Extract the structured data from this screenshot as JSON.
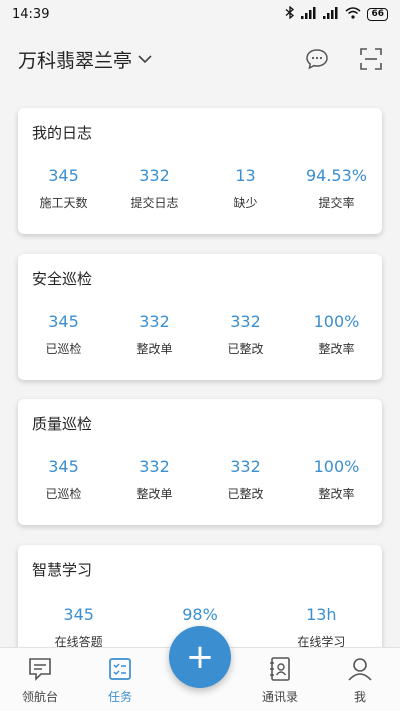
{
  "status_bar": {
    "time": "14:39",
    "battery": "66"
  },
  "header": {
    "project": "万科翡翠兰亭"
  },
  "cards": {
    "log": {
      "title": "我的日志",
      "stats": [
        {
          "value": "345",
          "label": "施工天数"
        },
        {
          "value": "332",
          "label": "提交日志"
        },
        {
          "value": "13",
          "label": "缺少"
        },
        {
          "value": "94.53%",
          "label": "提交率"
        }
      ]
    },
    "safety": {
      "title": "安全巡检",
      "stats": [
        {
          "value": "345",
          "label": "已巡检"
        },
        {
          "value": "332",
          "label": "整改单"
        },
        {
          "value": "332",
          "label": "已整改"
        },
        {
          "value": "100%",
          "label": "整改率"
        }
      ]
    },
    "quality": {
      "title": "质量巡检",
      "stats": [
        {
          "value": "345",
          "label": "已巡检"
        },
        {
          "value": "332",
          "label": "整改单"
        },
        {
          "value": "332",
          "label": "已整改"
        },
        {
          "value": "100%",
          "label": "整改率"
        }
      ]
    },
    "study": {
      "title": "智慧学习",
      "stats": [
        {
          "value": "345",
          "label": "在线答题"
        },
        {
          "value": "98%",
          "label": ""
        },
        {
          "value": "13h",
          "label": "在线学习"
        }
      ]
    }
  },
  "tabbar": {
    "items": [
      {
        "label": "领航台"
      },
      {
        "label": "任务"
      },
      {
        "label": "通讯录"
      },
      {
        "label": "我"
      }
    ],
    "fab": "+"
  },
  "colors": {
    "accent": "#3b8fd0",
    "background": "#f4f4f4"
  }
}
